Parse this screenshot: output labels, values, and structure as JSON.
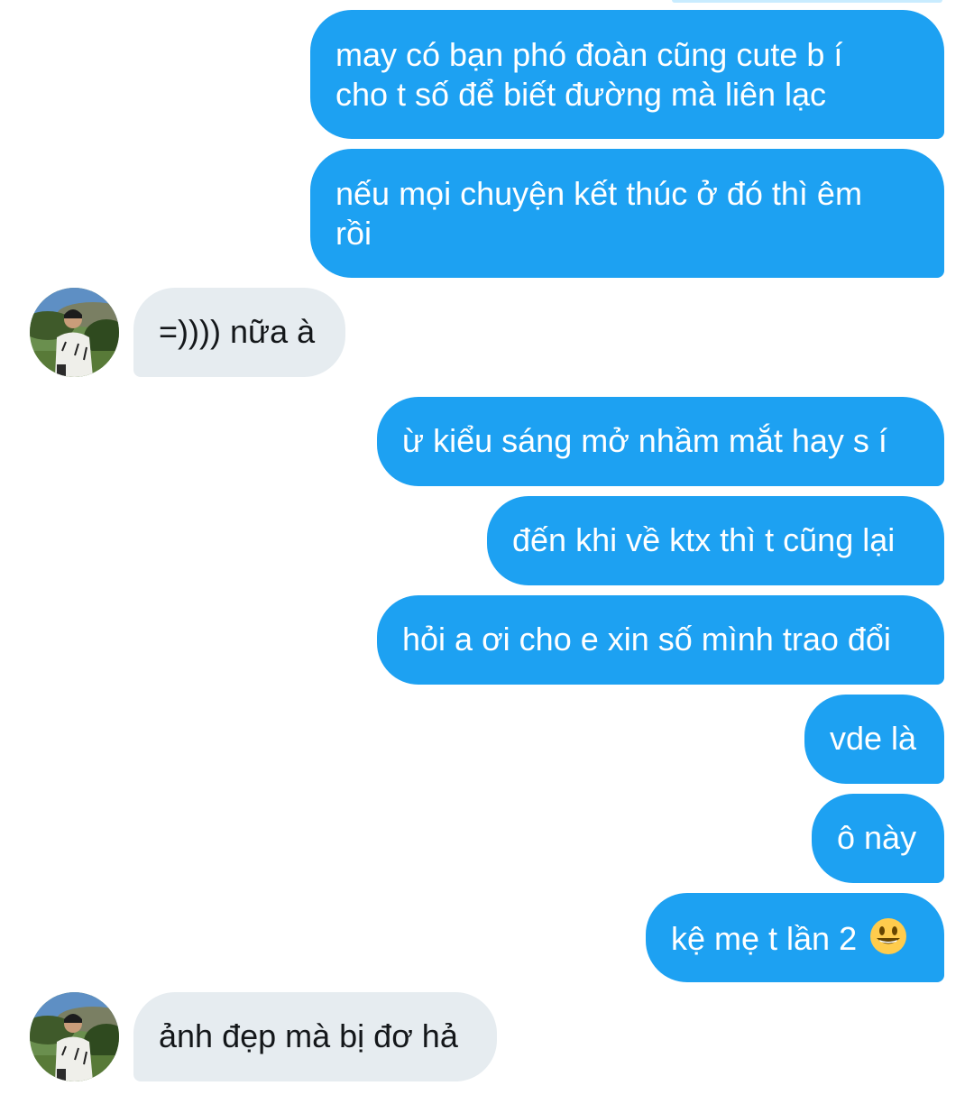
{
  "messages": [
    {
      "direction": "sent",
      "text": "may có bạn phó đoàn cũng cute b í\ncho t số để biết đường mà liên lạc"
    },
    {
      "direction": "sent",
      "text": "nếu mọi chuyện kết thúc ở đó thì êm\nrồi"
    },
    {
      "direction": "received",
      "text": "=)))) nữa à",
      "avatar": "user-avatar"
    },
    {
      "direction": "sent",
      "text": "ừ kiểu sáng mở nhầm mắt hay s í"
    },
    {
      "direction": "sent",
      "text": "đến khi về ktx thì t cũng lại"
    },
    {
      "direction": "sent",
      "text": "hỏi a ơi cho e xin số mình trao đổi"
    },
    {
      "direction": "sent",
      "text": "vde là"
    },
    {
      "direction": "sent",
      "text": "ô này"
    },
    {
      "direction": "sent",
      "text": "kệ mẹ t lần 2",
      "emoji": "smiley-face-icon"
    },
    {
      "direction": "received",
      "text": "ảnh đẹp mà bị đơ hả",
      "avatar": "user-avatar"
    }
  ],
  "colors": {
    "sent_bubble": "#1da1f2",
    "sent_text": "#ffffff",
    "received_bubble": "#e6ecf0",
    "received_text": "#14171a"
  }
}
